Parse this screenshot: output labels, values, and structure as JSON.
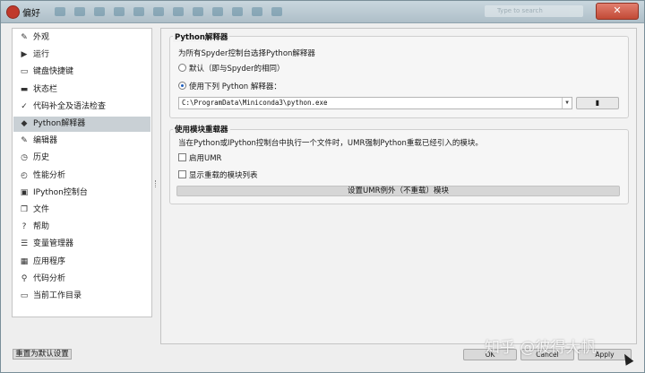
{
  "window": {
    "title": "偏好",
    "close_label": "✕",
    "search_placeholder": "Type to search"
  },
  "sidebar": {
    "items": [
      {
        "icon": "wrench-icon",
        "glyph": "✎",
        "label": "外观"
      },
      {
        "icon": "run-icon",
        "glyph": "▶",
        "label": "运行"
      },
      {
        "icon": "keyboard-icon",
        "glyph": "▭",
        "label": "键盘快捷键"
      },
      {
        "icon": "statusbar-icon",
        "glyph": "▬",
        "label": "状态栏"
      },
      {
        "icon": "completion-icon",
        "glyph": "✓",
        "label": "代码补全及语法检查"
      },
      {
        "icon": "python-icon",
        "glyph": "◆",
        "label": "Python解释器"
      },
      {
        "icon": "editor-icon",
        "glyph": "✎",
        "label": "编辑器"
      },
      {
        "icon": "history-icon",
        "glyph": "◷",
        "label": "历史"
      },
      {
        "icon": "profiler-icon",
        "glyph": "◴",
        "label": "性能分析"
      },
      {
        "icon": "ipython-icon",
        "glyph": "▣",
        "label": "IPython控制台"
      },
      {
        "icon": "files-icon",
        "glyph": "❐",
        "label": "文件"
      },
      {
        "icon": "help-icon",
        "glyph": "?",
        "label": "帮助"
      },
      {
        "icon": "variable-explorer-icon",
        "glyph": "☰",
        "label": "变量管理器"
      },
      {
        "icon": "apps-icon",
        "glyph": "▦",
        "label": "应用程序"
      },
      {
        "icon": "code-analysis-icon",
        "glyph": "⚲",
        "label": "代码分析"
      },
      {
        "icon": "folder-icon",
        "glyph": "▭",
        "label": "当前工作目录"
      }
    ],
    "active_index": 5
  },
  "interpreter": {
    "group_title": "Python解释器",
    "description": "为所有Spyder控制台选择Python解释器",
    "option_default": "默认（即与Spyder的相同）",
    "option_custom": "使用下列 Python 解释器：",
    "selected_option": "custom",
    "path_value": "C:\\ProgramData\\Miniconda3\\python.exe"
  },
  "umr": {
    "group_title": "使用模块重载器",
    "description": "当在Python或IPython控制台中执行一个文件时，UMR强制Python重载已经引入的模块。",
    "enable_label": "启用UMR",
    "show_list_label": "显示重载的模块列表",
    "exclude_button": "设置UMR例外（不重载）模块"
  },
  "footer": {
    "reset_label": "重置为默认设置",
    "ok_label": "OK",
    "cancel_label": "Cancel",
    "apply_label": "Apply"
  },
  "watermark": "知乎 @彼得大帆"
}
